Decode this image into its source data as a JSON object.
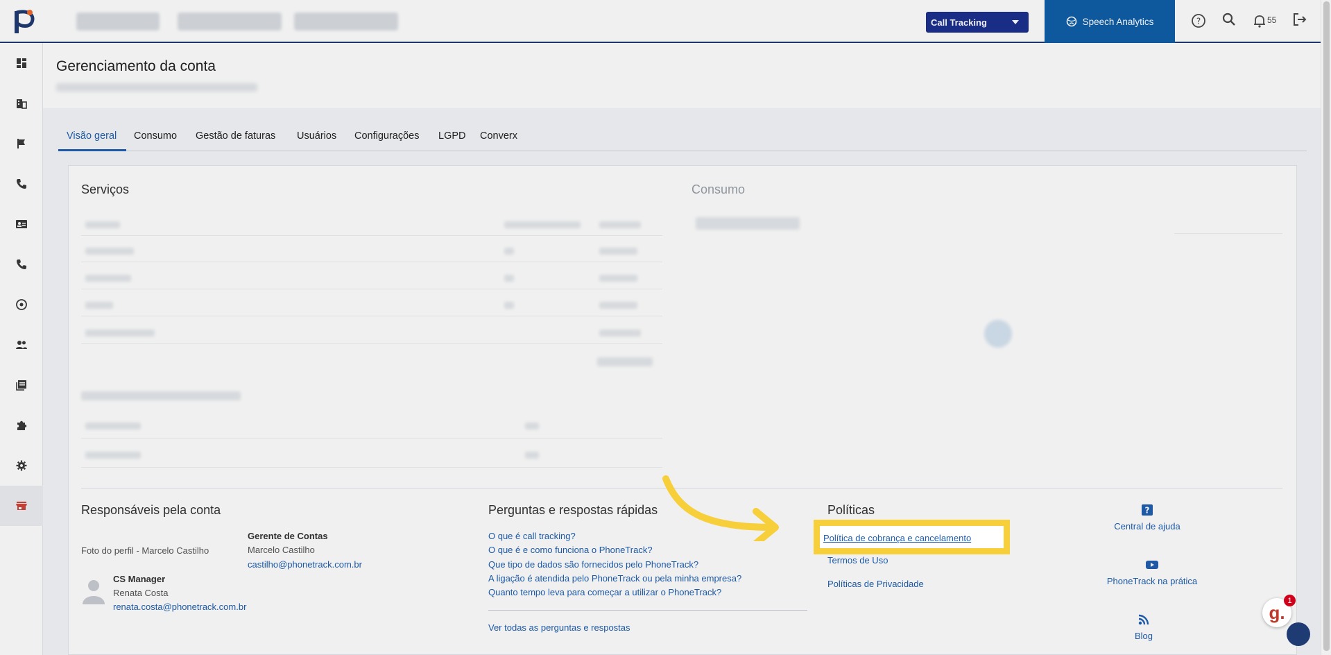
{
  "topbar": {
    "product_select": "Call Tracking",
    "speech_analytics": "Speech Analytics",
    "notifications_count": "55"
  },
  "page": {
    "title": "Gerenciamento da conta"
  },
  "tabs": [
    "Visão geral",
    "Consumo",
    "Gestão de faturas",
    "Usuários",
    "Configurações",
    "LGPD",
    "Converx"
  ],
  "services": {
    "title": "Serviços"
  },
  "consumption": {
    "title": "Consumo"
  },
  "responsaveis": {
    "title": "Responsáveis pela conta",
    "manager_photo_alt": "Foto do perfil - Marcelo Castilho",
    "manager_role": "Gerente de Contas",
    "manager_name": "Marcelo Castilho",
    "manager_email": "castilho@phonetrack.com.br",
    "cs_role": "CS Manager",
    "cs_name": "Renata Costa",
    "cs_email": "renata.costa@phonetrack.com.br"
  },
  "faq": {
    "title": "Perguntas e respostas rápidas",
    "items": [
      "O que é call tracking?",
      "O que é e como funciona o PhoneTrack?",
      "Que tipo de dados são fornecidos pelo PhoneTrack?",
      "A ligação é atendida pelo PhoneTrack ou pela minha empresa?",
      "Quanto tempo leva para começar a utilizar o PhoneTrack?"
    ],
    "see_all": "Ver todas as perguntas e respostas"
  },
  "policies": {
    "title": "Políticas",
    "billing": "Política de cobrança e cancelamento",
    "terms": "Termos de Uso",
    "privacy": "Políticas de Privacidade"
  },
  "help": {
    "central": "Central de ajuda",
    "practice": "PhoneTrack na prática",
    "blog": "Blog"
  },
  "widget": {
    "badge_letter": "g.",
    "badge_count": "1"
  },
  "colors": {
    "brand_blue": "#1f3b73",
    "link": "#1f5fb0",
    "highlight": "#f7cf3a",
    "speech_bg": "#0f5fa8"
  }
}
